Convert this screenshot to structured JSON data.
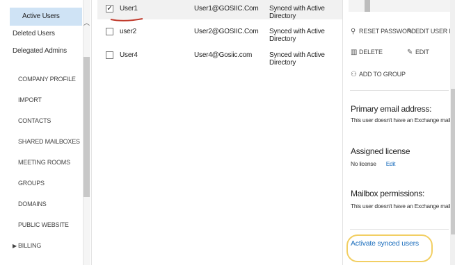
{
  "sidebar": {
    "sub_items": [
      {
        "label": "Active Users",
        "selected": true
      },
      {
        "label": "Deleted Users",
        "selected": false
      },
      {
        "label": "Delegated Admins",
        "selected": false
      }
    ],
    "main_items": [
      {
        "label": "COMPANY PROFILE"
      },
      {
        "label": "IMPORT"
      },
      {
        "label": "CONTACTS"
      },
      {
        "label": "SHARED MAILBOXES"
      },
      {
        "label": "MEETING ROOMS"
      },
      {
        "label": "GROUPS"
      },
      {
        "label": "DOMAINS"
      },
      {
        "label": "PUBLIC WEBSITE"
      },
      {
        "label": "BILLING"
      }
    ],
    "billing_caret": "▶",
    "scroll_up_icon": "chevron-up-icon"
  },
  "users": [
    {
      "name": "User1",
      "email": "User1@GOSIIC.Com",
      "status": "Synced with Active Directory",
      "checked": true,
      "check_glyph": "✓"
    },
    {
      "name": "user2",
      "email": "User2@GOSIIC.Com",
      "status": "Synced with Active Directory",
      "checked": false,
      "check_glyph": ""
    },
    {
      "name": "User4",
      "email": "User4@Gosiic.com",
      "status": "Synced with Active Directory",
      "checked": false,
      "check_glyph": ""
    }
  ],
  "details": {
    "actions": {
      "reset_password": "RESET PASSWORD",
      "edit_user_roles": "EDIT USER ROL",
      "delete": "DELETE",
      "edit": "EDIT",
      "add_to_group": "ADD TO GROUP"
    },
    "primary_email": {
      "title": "Primary email address:",
      "text": "This user doesn't have an Exchange mailbox."
    },
    "assigned_license": {
      "title": "Assigned license",
      "value": "No license",
      "edit_link": "Edit"
    },
    "mailbox_permissions": {
      "title": "Mailbox permissions:",
      "text": "This user doesn't have an Exchange mailbox."
    },
    "activate_link": "Activate synced users"
  },
  "colors": {
    "selected_nav": "#cfe3f5",
    "link": "#1e6fbd",
    "highlight_ring": "#f2cf63",
    "annotation_underline": "#c0392b"
  }
}
